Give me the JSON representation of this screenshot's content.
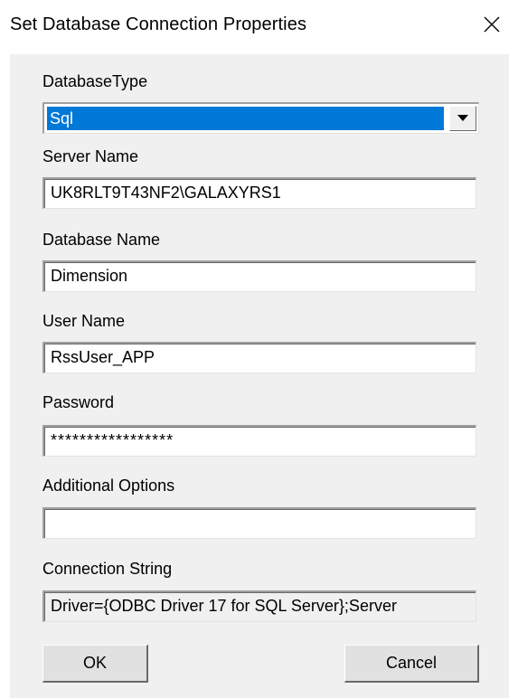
{
  "window": {
    "title": "Set Database Connection Properties"
  },
  "form": {
    "database_type_label": "DatabaseType",
    "database_type_value": "Sql",
    "server_name_label": "Server Name",
    "server_name_value": "UK8RLT9T43NF2\\GALAXYRS1",
    "database_name_label": "Database Name",
    "database_name_value": "Dimension",
    "user_name_label": "User Name",
    "user_name_value": "RssUser_APP",
    "password_label": "Password",
    "password_value": "*****************",
    "additional_options_label": "Additional Options",
    "additional_options_value": "",
    "connection_string_label": "Connection String",
    "connection_string_value": "Driver={ODBC Driver 17 for SQL Server};Server"
  },
  "buttons": {
    "ok_label": "OK",
    "cancel_label": "Cancel"
  },
  "icons": {
    "close": "close-icon",
    "dropdown": "chevron-down-icon"
  },
  "colors": {
    "selection": "#0078d7",
    "dialog_background": "#f0f0f0"
  }
}
